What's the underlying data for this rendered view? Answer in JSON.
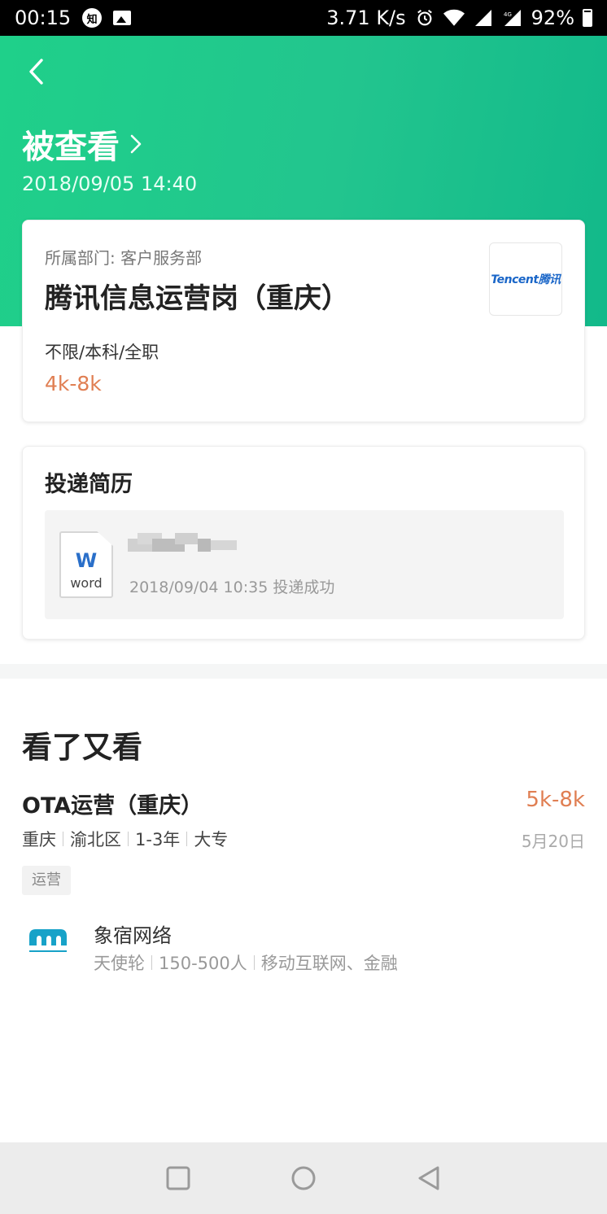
{
  "status_bar": {
    "time": "00:15",
    "notification_badge": "知",
    "speed": "3.71 K/s",
    "battery": "92%",
    "icons": [
      "image-icon",
      "alarm-icon",
      "wifi-icon",
      "signal-icon",
      "battery-icon"
    ]
  },
  "header": {
    "title": "被查看",
    "date": "2018/09/05 14:40",
    "colors": {
      "gradient_start": "#1fd08a",
      "gradient_end": "#12b98a"
    }
  },
  "job": {
    "department": "所属部门: 客户服务部",
    "title": "腾讯信息运营岗（重庆）",
    "logo_text": "Tencent腾讯",
    "meta": "不限/本科/全职",
    "salary": "4k-8k"
  },
  "resume": {
    "heading": "投递简历",
    "file_type_letter": "W",
    "file_type_label": "word",
    "time_status": "2018/09/04 10:35 投递成功"
  },
  "recommendations": {
    "heading": "看了又看",
    "items": [
      {
        "title": "OTA运营（重庆）",
        "salary": "5k-8k",
        "meta": [
          "重庆",
          "渝北区",
          "1-3年",
          "大专"
        ],
        "date": "5月20日",
        "tag": "运营",
        "company": {
          "name": "象宿网络",
          "meta": [
            "天使轮",
            "150-500人",
            "移动互联网、金融"
          ]
        }
      }
    ]
  },
  "nav": {
    "buttons": [
      "square-recent-icon",
      "circle-home-icon",
      "triangle-back-icon"
    ]
  },
  "colors": {
    "accent_green": "#1fc98c",
    "salary_orange": "#e07f53"
  }
}
